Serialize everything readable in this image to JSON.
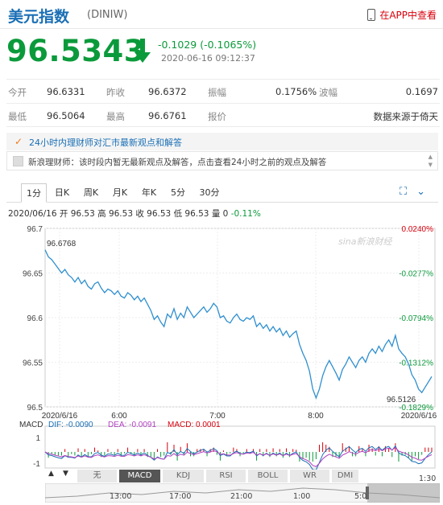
{
  "header": {
    "title": "美元指数",
    "code": "(DINIW)",
    "app_link": "在APP中查看"
  },
  "quote": {
    "price": "96.5343",
    "change": "-0.1029 (-0.1065%)",
    "timestamp": "2020-06-16 09:12:37",
    "direction": "down",
    "color_down": "#0b9a3b"
  },
  "stats": {
    "row1": [
      {
        "label": "今开",
        "value": "96.6331"
      },
      {
        "label": "昨收",
        "value": "96.6372"
      },
      {
        "label": "振幅",
        "value": "0.1756%"
      },
      {
        "label": "波幅",
        "value": "0.1697"
      }
    ],
    "row2": [
      {
        "label": "最低",
        "value": "96.5064"
      },
      {
        "label": "最高",
        "value": "96.6761"
      },
      {
        "label": "报价",
        "value": "数据来源于倚天"
      }
    ]
  },
  "analyst": {
    "headline": "24小时内理财师对汇市最新观点和解答",
    "message": "新浪理财师：该时段内暂无最新观点及解答，点击查看24小时之前的观点及解答"
  },
  "tabs": [
    "1分",
    "日K",
    "周K",
    "月K",
    "年K",
    "5分",
    "30分"
  ],
  "active_tab": "1分",
  "chart_info": {
    "date": "2020/06/16",
    "text": "开 96.53 高 96.53 收 96.53 低 96.53 量 0",
    "change": "-0.11%"
  },
  "chart_data": {
    "type": "line",
    "title": "",
    "x_ticks": [
      "2020/6/16",
      "6:00",
      "7:00",
      "8:00",
      "2020/6/16"
    ],
    "y_ticks": [
      "96.7",
      "96.65",
      "96.6",
      "96.55",
      "96.5"
    ],
    "right_ticks": [
      "0.0240%",
      "-0.0277%",
      "-0.0794%",
      "-0.1312%",
      "-0.1829%"
    ],
    "ylim": [
      96.5,
      96.7
    ],
    "max_label": "96.6768",
    "min_label": "96.5126",
    "watermark": "sina新浪财经",
    "series": [
      {
        "values": [
          96.676,
          96.668,
          96.665,
          96.66,
          96.655,
          96.65,
          96.654,
          96.648,
          96.645,
          96.64,
          96.645,
          96.638,
          96.642,
          96.635,
          96.632,
          96.638,
          96.64,
          96.633,
          96.628,
          96.632,
          96.63,
          96.626,
          96.63,
          96.624,
          96.622,
          96.628,
          96.625,
          96.62,
          96.624,
          96.618,
          96.622,
          96.615,
          96.608,
          96.598,
          96.602,
          96.595,
          96.59,
          96.604,
          96.6,
          96.61,
          96.598,
          96.605,
          96.6,
          96.612,
          96.606,
          96.6,
          96.604,
          96.608,
          96.612,
          96.606,
          96.61,
          96.616,
          96.612,
          96.6,
          96.602,
          96.596,
          96.594,
          96.6,
          96.604,
          96.598,
          96.596,
          96.6,
          96.598,
          96.602,
          96.59,
          96.594,
          96.588,
          96.592,
          96.585,
          96.59,
          96.584,
          96.588,
          96.58,
          96.585,
          96.578,
          96.582,
          96.585,
          96.57,
          96.56,
          96.552,
          96.54,
          96.52,
          96.51,
          96.52,
          96.535,
          96.545,
          96.552,
          96.545,
          96.538,
          96.53,
          96.542,
          96.548,
          96.556,
          96.55,
          96.544,
          96.552,
          96.556,
          96.55,
          96.56,
          96.565,
          96.56,
          96.568,
          96.562,
          96.57,
          96.575,
          96.568,
          96.58,
          96.565,
          96.56,
          96.556,
          96.548,
          96.536,
          96.53,
          96.52,
          96.516,
          96.522,
          96.528,
          96.534
        ]
      }
    ],
    "macd": {
      "dif_label": "DIF: -0.0090",
      "dea_label": "DEA: -0.0091",
      "macd_label": "MACD: 0.0001",
      "y_ticks": [
        "1",
        "-1"
      ]
    }
  },
  "indicators": [
    "无",
    "MACD",
    "KDJ",
    "RSI",
    "BOLL",
    "WR",
    "DMI"
  ],
  "active_indicator": "MACD",
  "nav": {
    "prev": "▲",
    "next": "▼"
  },
  "timeline": {
    "labels": [
      "13:00",
      "17:00",
      "21:00",
      "1:00",
      "5:0",
      "1:30"
    ]
  }
}
